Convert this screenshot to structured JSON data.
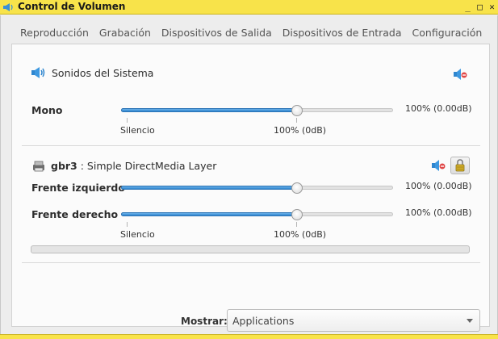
{
  "window": {
    "title": "Control de Volumen",
    "buttons": {
      "minimize": "_",
      "maximize": "□",
      "close": "✕"
    }
  },
  "tabs": [
    "Reproducción",
    "Grabación",
    "Dispositivos de Salida",
    "Dispositivos de Entrada",
    "Configuración"
  ],
  "system_sounds": {
    "title": "Sonidos del Sistema",
    "icon": "speaker-icon",
    "channels": [
      {
        "label": "Mono",
        "value_text": "100% (0.00dB)",
        "level": 1.0
      }
    ],
    "ticks": {
      "silence": "Silencio",
      "full": "100% (0dB)"
    },
    "mute_icon": "speaker-mute-icon"
  },
  "stream": {
    "app_name": "gbr3",
    "description": " : Simple DirectMedia Layer",
    "icon": "printer-icon",
    "channels": [
      {
        "label": "Frente izquierdo",
        "value_text": "100% (0.00dB)",
        "level": 1.0
      },
      {
        "label": "Frente derecho",
        "value_text": "100% (0.00dB)",
        "level": 1.0
      }
    ],
    "ticks": {
      "silence": "Silencio",
      "full": "100% (0dB)"
    },
    "mute_icon": "speaker-mute-icon",
    "lock_icon": "lock-channels-icon",
    "peak_level": 0.0
  },
  "show": {
    "label": "Mostrar:",
    "selected": "Applications"
  },
  "colors": {
    "titlebar": "#f8e34a",
    "slider_fill": "#2f86cf"
  }
}
